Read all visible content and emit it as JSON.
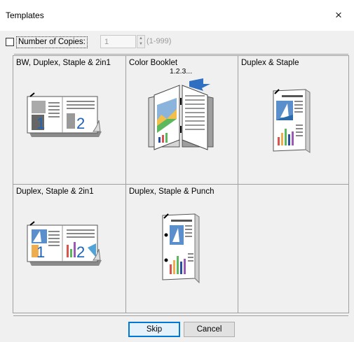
{
  "window": {
    "title": "Templates",
    "close_label": "×"
  },
  "copies": {
    "label": "Number of Copies:",
    "value": "1",
    "range": "(1-999)",
    "checked": false
  },
  "templates": [
    {
      "label": "BW, Duplex, Staple & 2in1",
      "icon": "bw-duplex-staple-2in1-icon"
    },
    {
      "label": "Color Booklet",
      "icon": "color-booklet-icon",
      "page_text": "1.2.3..."
    },
    {
      "label": "Duplex & Staple",
      "icon": "duplex-staple-icon"
    },
    {
      "label": "Duplex, Staple & 2in1",
      "icon": "duplex-staple-2in1-icon"
    },
    {
      "label": "Duplex, Staple & Punch",
      "icon": "duplex-staple-punch-icon"
    },
    {
      "label": "",
      "icon": ""
    }
  ],
  "buttons": {
    "skip": "Skip",
    "cancel": "Cancel"
  },
  "colors": {
    "accent": "#0078d7",
    "border": "#a0a0a0",
    "background": "#f0f0f0"
  }
}
